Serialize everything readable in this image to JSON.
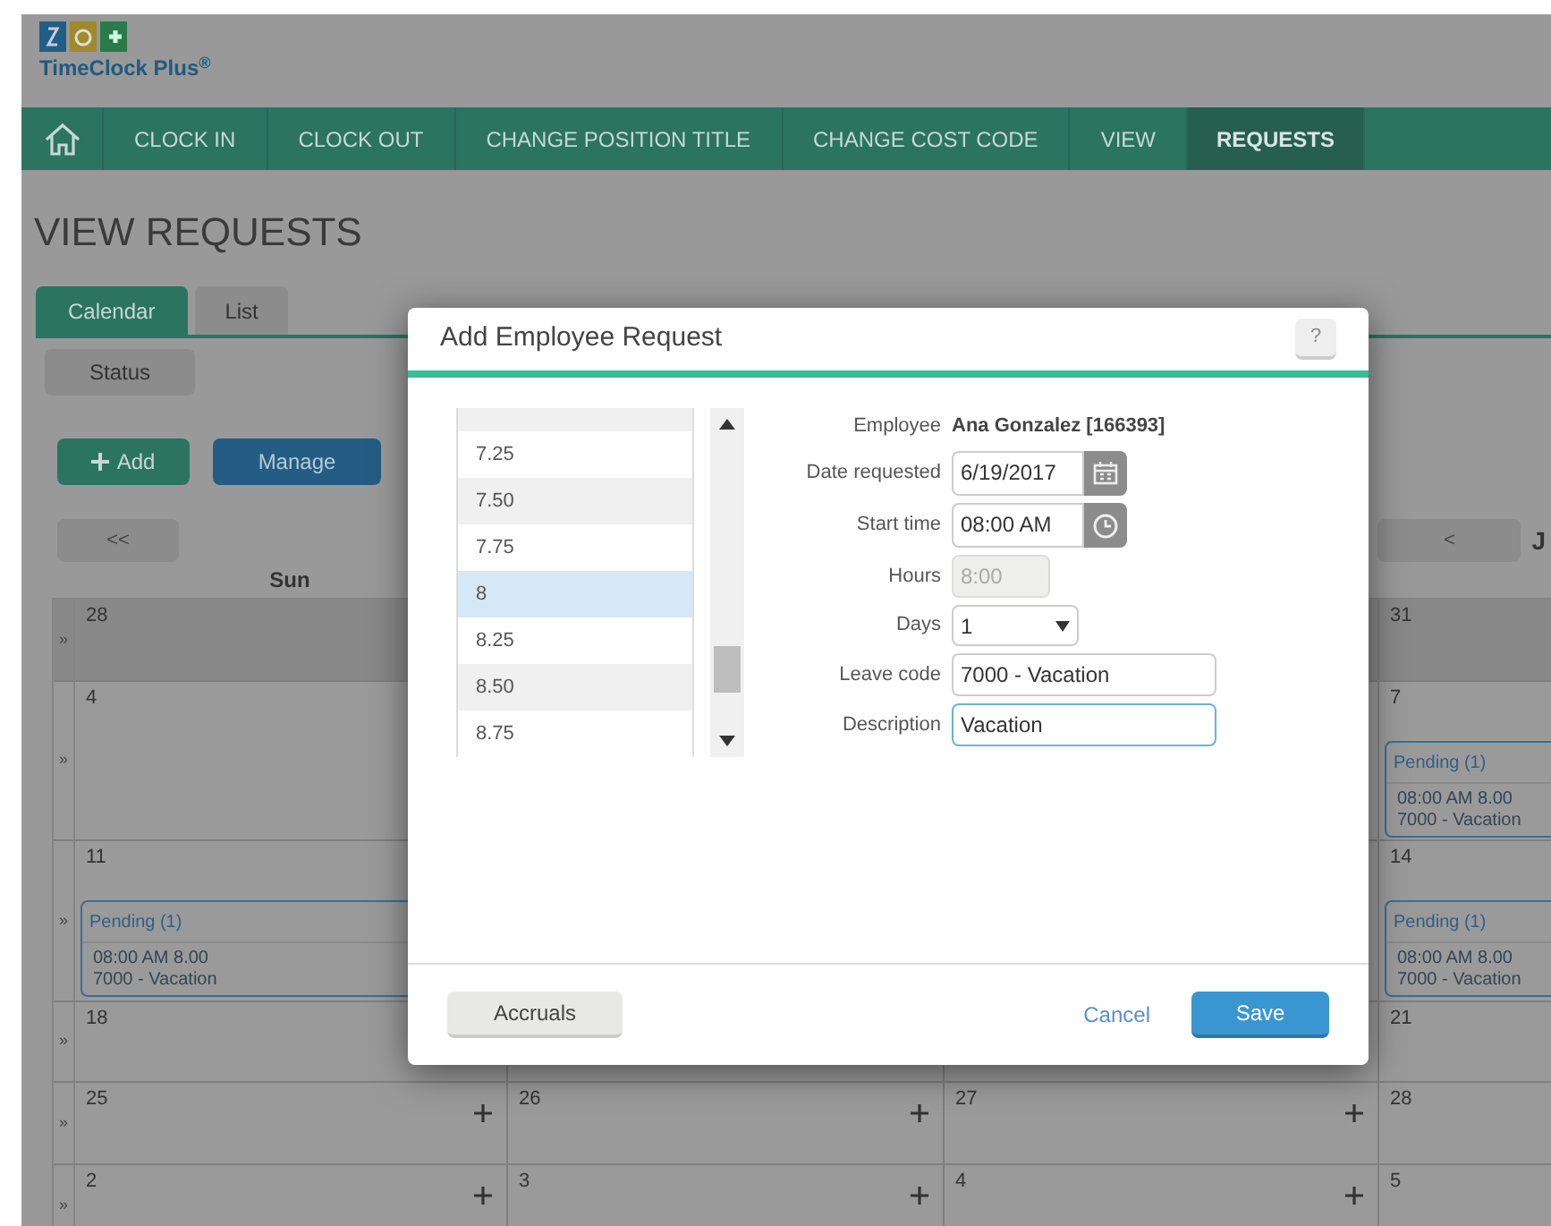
{
  "logo": {
    "text": "TimeClock Plus$^{®}$"
  },
  "nav": [
    {
      "label": "CLOCK IN",
      "selected": false
    },
    {
      "label": "CLOCK OUT",
      "selected": false
    },
    {
      "label": "CHANGE POSITION TITLE",
      "selected": false
    },
    {
      "label": "CHANGE COST CODE",
      "selected": false
    },
    {
      "label": "VIEW",
      "selected": false
    },
    {
      "label": "REQUESTS",
      "selected": true
    }
  ],
  "page_title": "VIEW REQUESTS",
  "view_tabs": [
    {
      "label": "Calendar",
      "selected": true
    },
    {
      "label": "List",
      "selected": false
    }
  ],
  "status_button": "Status",
  "add_button": "Add",
  "manage_button": "Manage",
  "prev_button": "<<",
  "prev_week_button": "<",
  "day_header": "Sun",
  "month_title": "J",
  "weeks": [
    {
      "toggle": "»",
      "outside_month": true,
      "cells": [
        {
          "day": "28"
        },
        {},
        {},
        {
          "day": "31"
        }
      ]
    },
    {
      "toggle": "»",
      "outside_month": false,
      "cells": [
        {
          "day": "4"
        },
        {},
        {},
        {
          "day": "7",
          "events": [
            {
              "title": "Pending (1)",
              "time": "08:00 AM 8.00",
              "code": "7000 - Vacation"
            }
          ]
        }
      ]
    },
    {
      "toggle": "»",
      "outside_month": false,
      "cells": [
        {
          "day": "11",
          "events": [
            {
              "title": "Pending (1)",
              "time": "08:00 AM 8.00",
              "code": "7000 - Vacation"
            }
          ]
        },
        {},
        {},
        {
          "day": "14",
          "events": [
            {
              "title": "Pending (1)",
              "time": "08:00 AM 8.00",
              "code": "7000 - Vacation"
            }
          ]
        }
      ]
    },
    {
      "toggle": "»",
      "outside_month": false,
      "cells": [
        {
          "day": "18"
        },
        {},
        {},
        {
          "day": "21"
        }
      ]
    },
    {
      "toggle": "»",
      "outside_month": false,
      "cells": [
        {
          "day": "25",
          "add": true
        },
        {
          "day": "26",
          "add": true
        },
        {
          "day": "27",
          "add": true
        },
        {
          "day": "28"
        }
      ]
    },
    {
      "toggle": "»",
      "outside_month": false,
      "cells": [
        {
          "day": "2",
          "add": true
        },
        {
          "day": "3",
          "add": true
        },
        {
          "day": "4",
          "add": true
        },
        {
          "day": "5"
        }
      ]
    }
  ],
  "modal": {
    "title": "Add Employee Request",
    "help": "?",
    "hours_list": [
      {
        "label": "7.25",
        "selected": false
      },
      {
        "label": "7.50",
        "selected": false
      },
      {
        "label": "7.75",
        "selected": false
      },
      {
        "label": "8",
        "selected": true
      },
      {
        "label": "8.25",
        "selected": false
      },
      {
        "label": "8.50",
        "selected": false
      },
      {
        "label": "8.75",
        "selected": false
      }
    ],
    "fields": [
      {
        "kind": "static",
        "label": "Employee",
        "value": "Ana Gonzalez [166393]"
      },
      {
        "kind": "date",
        "label": "Date requested",
        "value": "6/19/2017"
      },
      {
        "kind": "time",
        "label": "Start time",
        "value": "08:00 AM"
      },
      {
        "kind": "disabled",
        "label": "Hours",
        "value": "8:00"
      },
      {
        "kind": "select",
        "label": "Days",
        "value": "1"
      },
      {
        "kind": "combo",
        "label": "Leave code",
        "value": "7000 - Vacation"
      },
      {
        "kind": "text",
        "label": "Description",
        "value": "Vacation",
        "focused": true
      }
    ],
    "accruals_button": "Accruals",
    "cancel_link": "Cancel",
    "save_button": "Save"
  }
}
